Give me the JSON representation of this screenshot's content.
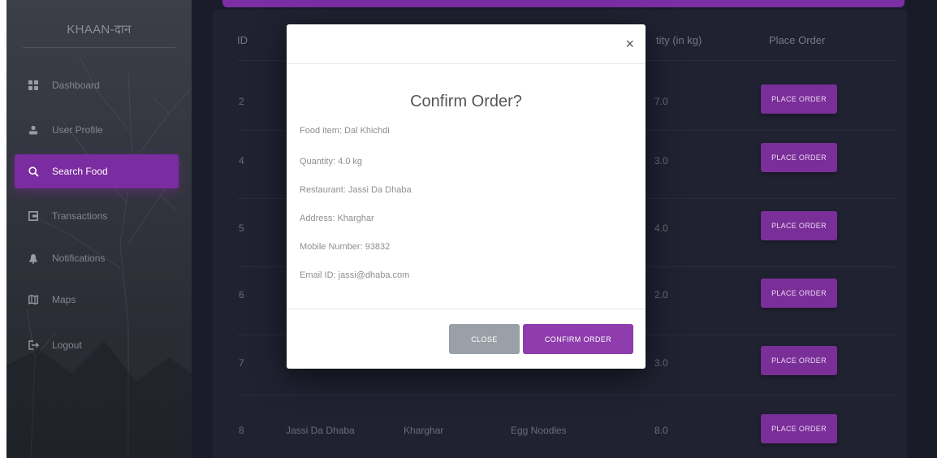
{
  "brand": {
    "title": "KHAAN-दान"
  },
  "sidebar": {
    "items": [
      {
        "label": "Dashboard",
        "icon": "dashboard-icon",
        "active": false
      },
      {
        "label": "User Profile",
        "icon": "user-icon",
        "active": false
      },
      {
        "label": "Search Food",
        "icon": "search-icon",
        "active": true
      },
      {
        "label": "Transactions",
        "icon": "wallet-icon",
        "active": false
      },
      {
        "label": "Notifications",
        "icon": "bell-icon",
        "active": false
      },
      {
        "label": "Maps",
        "icon": "map-icon",
        "active": false
      },
      {
        "label": "Logout",
        "icon": "logout-icon",
        "active": false
      }
    ]
  },
  "table": {
    "headers": {
      "id": "ID",
      "quantity": "tity (in kg)",
      "place_order": "Place Order"
    },
    "rows": [
      {
        "id": "2",
        "restaurant": "",
        "address": "",
        "food": "",
        "quantity": "7.0",
        "button": "PLACE ORDER"
      },
      {
        "id": "4",
        "restaurant": "",
        "address": "",
        "food": "",
        "quantity": "3.0",
        "button": "PLACE ORDER"
      },
      {
        "id": "5",
        "restaurant": "",
        "address": "",
        "food": "",
        "quantity": "4.0",
        "button": "PLACE ORDER"
      },
      {
        "id": "6",
        "restaurant": "",
        "address": "",
        "food": "",
        "quantity": "2.0",
        "button": "PLACE ORDER"
      },
      {
        "id": "7",
        "restaurant": "",
        "address": "",
        "food": "",
        "quantity": "3.0",
        "button": "PLACE ORDER"
      },
      {
        "id": "8",
        "restaurant": "Jassi Da Dhaba",
        "address": "Kharghar",
        "food": "Egg Noodles",
        "quantity": "8.0",
        "button": "PLACE ORDER"
      }
    ]
  },
  "modal": {
    "close_symbol": "×",
    "title": "Confirm Order?",
    "lines": [
      "Food item: Dal Khichdi",
      "Quantity: 4.0 kg",
      "Restaurant: Jassi Da Dhaba",
      "Address: Kharghar",
      "Mobile Number: 93832",
      "Email ID: jassi@dhaba.com"
    ],
    "close_label": "CLOSE",
    "confirm_label": "CONFIRM ORDER"
  },
  "colors": {
    "accent": "#7a2ca0",
    "background": "#1a1c2b",
    "sidebar": "#33353e",
    "button": "#7a2f98",
    "close_button": "#9aa0a8"
  }
}
